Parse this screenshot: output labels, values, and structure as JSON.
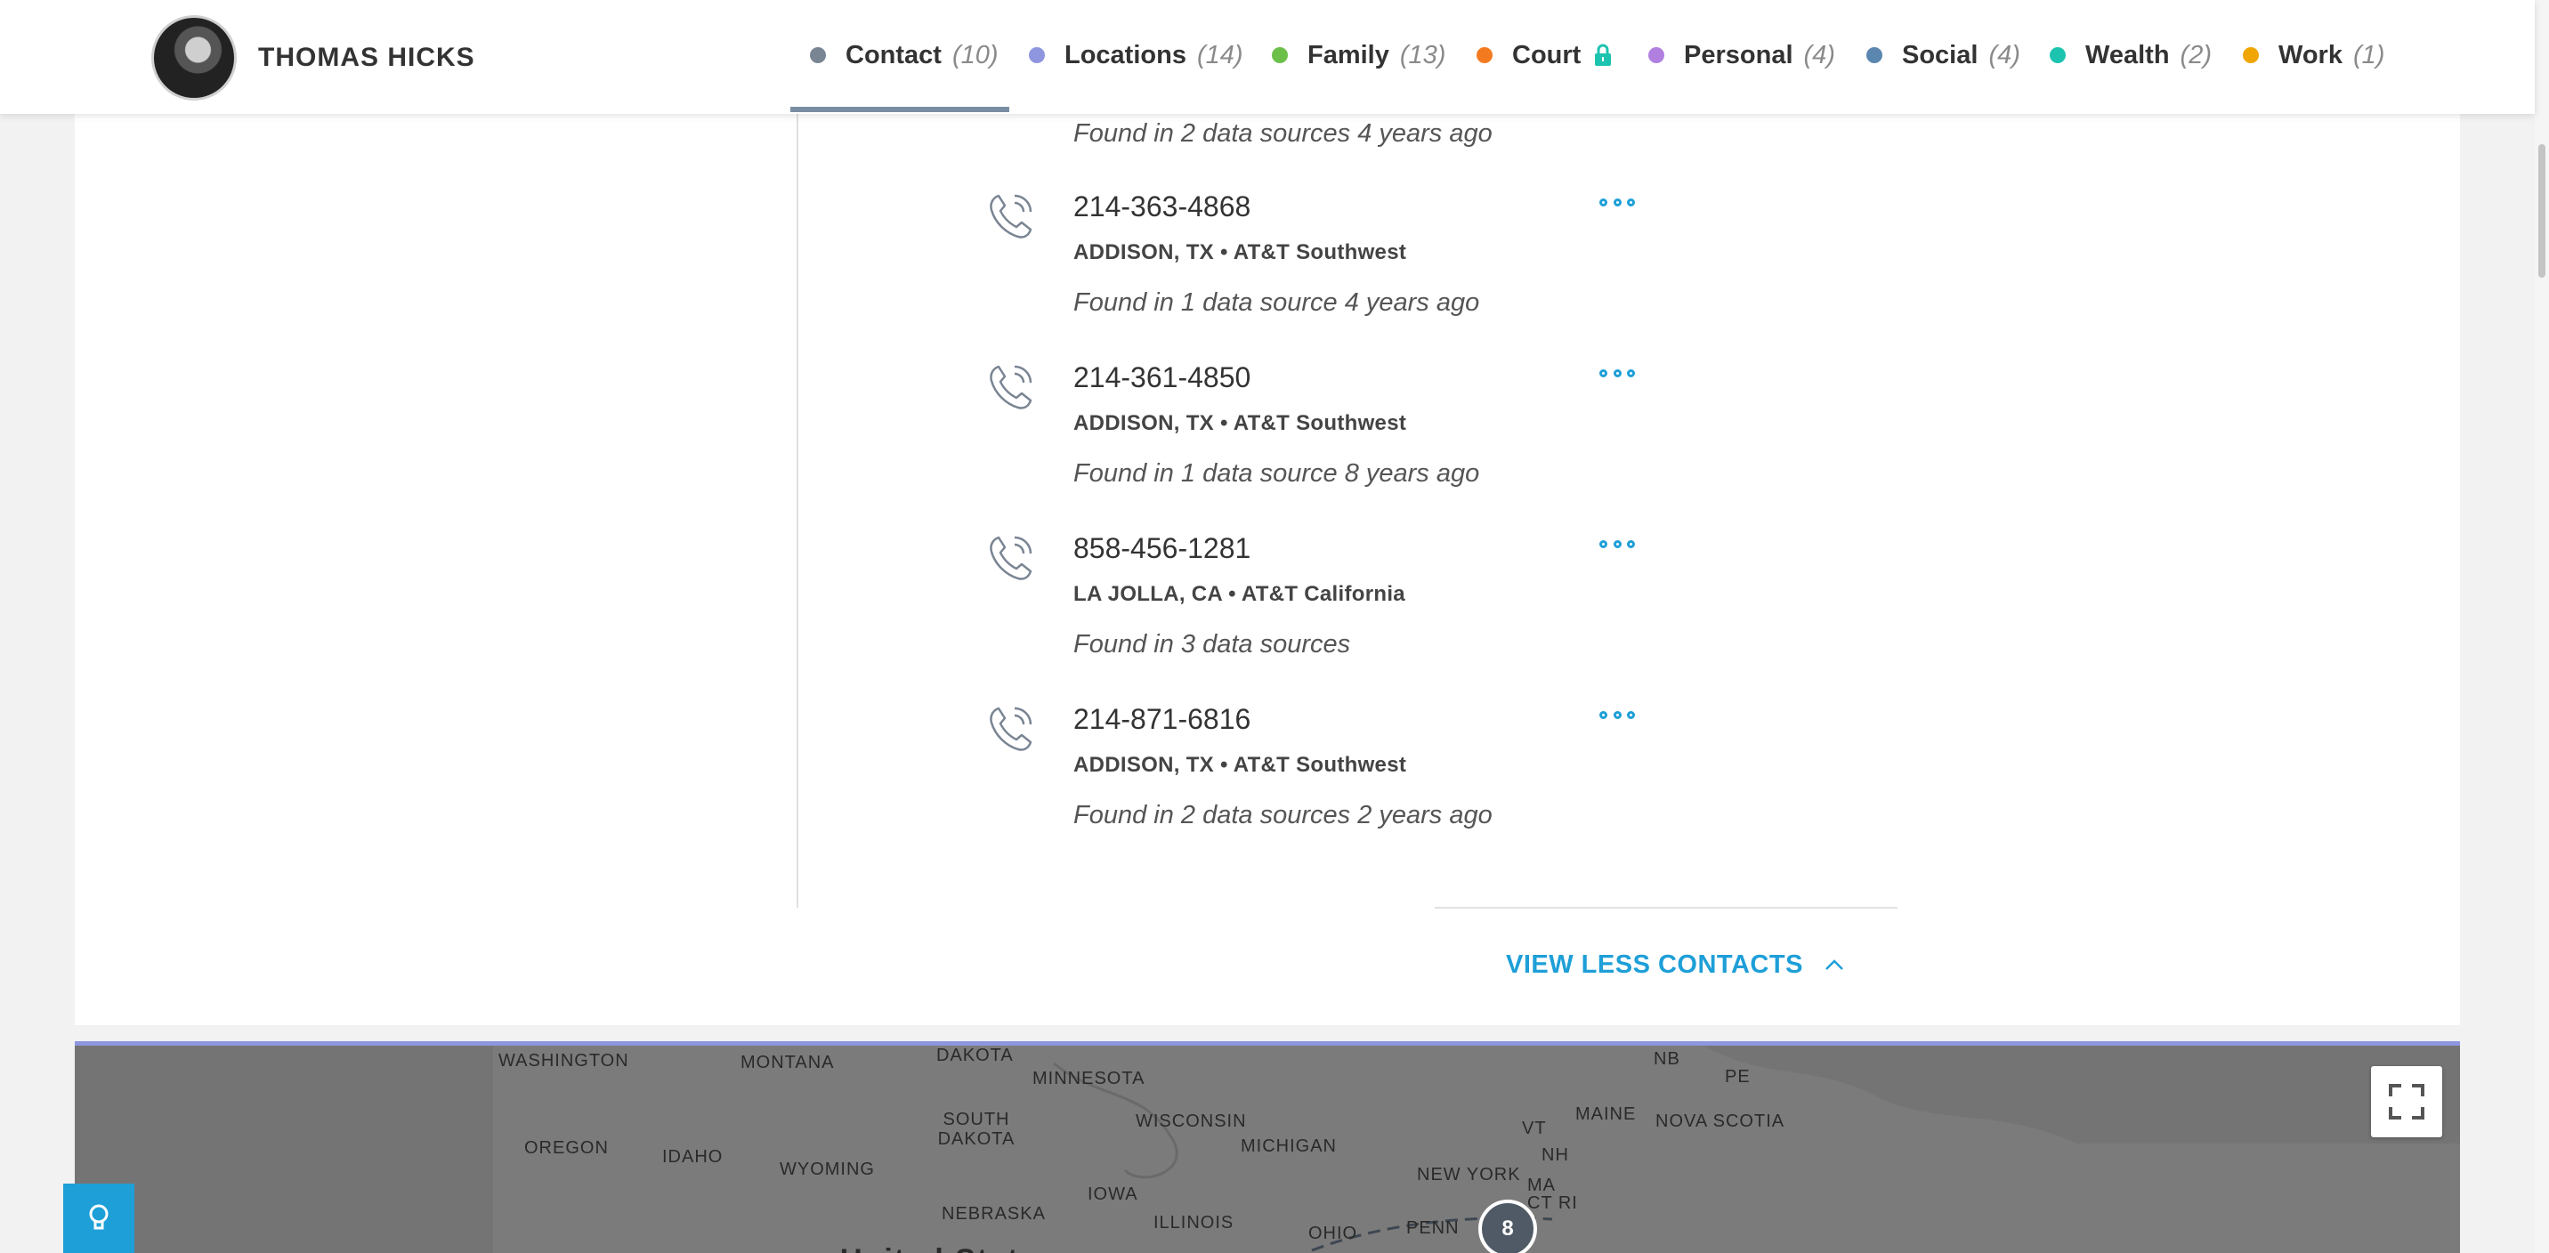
{
  "header": {
    "person_name": "THOMAS HICKS",
    "tabs": [
      {
        "label": "Contact",
        "count": "(10)",
        "color": "#7a8593",
        "active": true
      },
      {
        "label": "Locations",
        "count": "(14)",
        "color": "#8e96e0"
      },
      {
        "label": "Family",
        "count": "(13)",
        "color": "#6cc04a"
      },
      {
        "label": "Court",
        "count": "",
        "color": "#f47a20",
        "locked": true
      },
      {
        "label": "Personal",
        "count": "(4)",
        "color": "#b07fe0"
      },
      {
        "label": "Social",
        "count": "(4)",
        "color": "#5b86b0"
      },
      {
        "label": "Wealth",
        "count": "(2)",
        "color": "#1cc4b0"
      },
      {
        "label": "Work",
        "count": "(1)",
        "color": "#f0a500"
      }
    ]
  },
  "contacts": {
    "partial_found": "Found in 2 data sources 4 years ago",
    "items": [
      {
        "number": "214-363-4868",
        "location": "ADDISON, TX • AT&T Southwest",
        "found": "Found in 1 data source 4 years ago"
      },
      {
        "number": "214-361-4850",
        "location": "ADDISON, TX • AT&T Southwest",
        "found": "Found in 1 data source 8 years ago"
      },
      {
        "number": "858-456-1281",
        "location": "LA JOLLA, CA • AT&T California",
        "found": "Found in 3 data sources"
      },
      {
        "number": "214-871-6816",
        "location": "ADDISON, TX • AT&T Southwest",
        "found": "Found in 2 data sources 2 years ago"
      }
    ],
    "view_less_label": "VIEW LESS CONTACTS"
  },
  "map": {
    "labels": [
      "WASHINGTON",
      "MONTANA",
      "DAKOTA",
      "MINNESOTA",
      "NB",
      "PE",
      "OREGON",
      "IDAHO",
      "WYOMING",
      "SOUTH DAKOTA",
      "WISCONSIN",
      "MICHIGAN",
      "MAINE",
      "NOVA SCOTIA",
      "VT",
      "NH",
      "MA",
      "NEW YORK",
      "CT RI",
      "NEBRASKA",
      "IOWA",
      "ILLINOIS",
      "OHIO",
      "PENN",
      "United States"
    ],
    "cluster_count": "8"
  },
  "colors": {
    "accent": "#1e9fd8",
    "header_bg": "#ffffff",
    "map_bg": "#7e7e7e"
  }
}
